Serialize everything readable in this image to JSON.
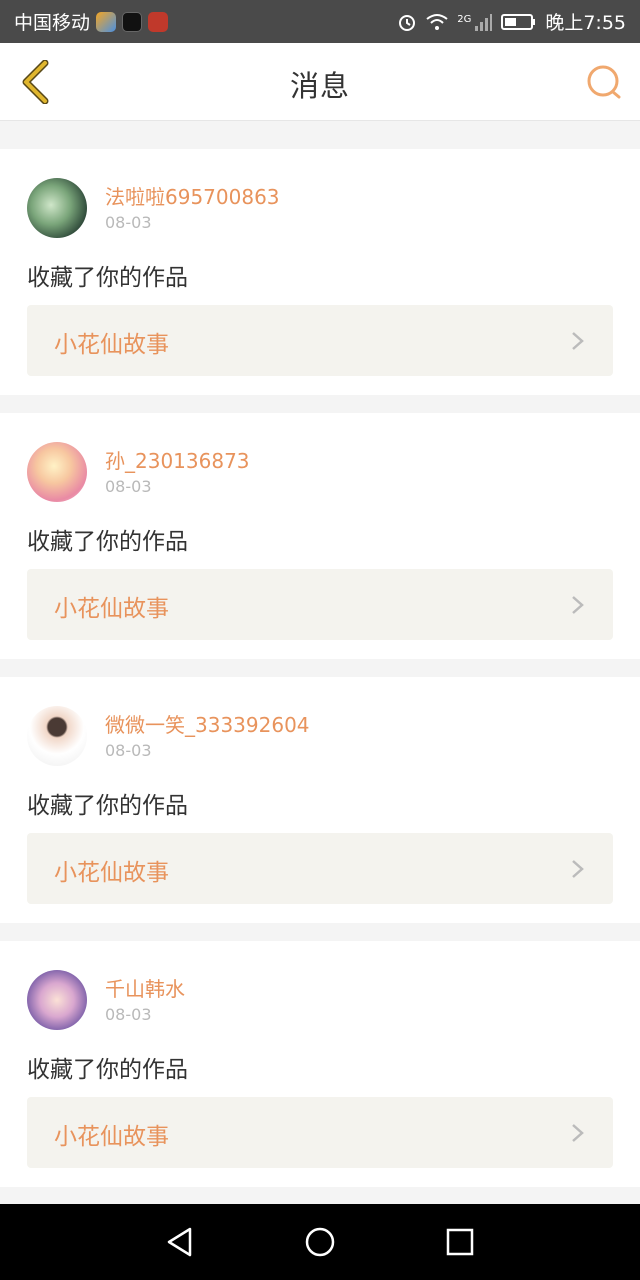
{
  "status_bar": {
    "carrier": "中国移动",
    "time": "晚上7:55",
    "network": "2G"
  },
  "header": {
    "title": "消息"
  },
  "messages": [
    {
      "username": "法啦啦695700863",
      "date": "08-03",
      "action": "收藏了你的作品",
      "work_title": "小花仙故事"
    },
    {
      "username": "孙_230136873",
      "date": "08-03",
      "action": "收藏了你的作品",
      "work_title": "小花仙故事"
    },
    {
      "username": "微微一笑_333392604",
      "date": "08-03",
      "action": "收藏了你的作品",
      "work_title": "小花仙故事"
    },
    {
      "username": "千山韩水",
      "date": "08-03",
      "action": "收藏了你的作品",
      "work_title": "小花仙故事"
    }
  ],
  "colors": {
    "accent": "#e8935c",
    "back_icon": "#c9a227",
    "status_bg": "#4a4a4a",
    "card_bg": "#ffffff",
    "link_bg": "#f4f3ee"
  },
  "icons": {
    "back": "chevron-left-icon",
    "search": "search-icon",
    "row_arrow": "chevron-right-icon",
    "nav_back": "triangle-back-icon",
    "nav_home": "circle-home-icon",
    "nav_recent": "square-recent-icon"
  }
}
